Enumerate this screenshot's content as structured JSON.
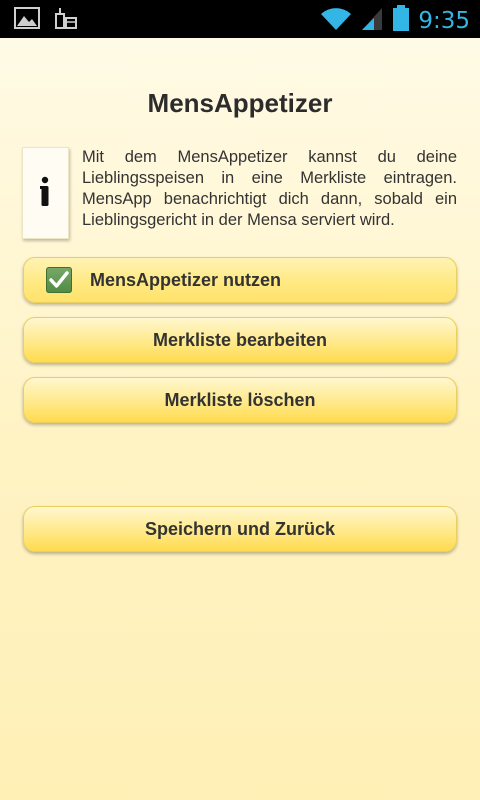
{
  "status_bar": {
    "time": "9:35",
    "icons": [
      "image-icon",
      "calendar-icon",
      "wifi-icon",
      "signal-icon",
      "battery-icon"
    ],
    "accent_color": "#33b5e5"
  },
  "screen": {
    "title": "MensAppetizer",
    "info_text": "Mit dem MensAppetizer kannst du deine Lieblingsspeisen in eine Merkliste eintragen. MensApp benachrichtigt dich dann, sobald ein Lieblingsgericht in der Mensa serviert wird.",
    "toggle": {
      "label": "MensAppetizer nutzen",
      "checked": true
    },
    "buttons": {
      "edit_list": "Merkliste bearbeiten",
      "clear_list": "Merkliste löschen",
      "save_back": "Speichern und Zurück"
    }
  },
  "colors": {
    "button_yellow": "#ffe98a",
    "checkbox_green": "#5a9a4c",
    "text_dark": "#333333"
  }
}
